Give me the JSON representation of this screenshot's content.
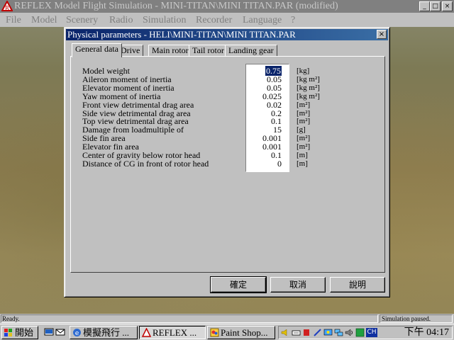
{
  "app": {
    "title": "REFLEX Model Flight Simulation - MINI-TITAN\\MINI TITAN.PAR (modified)",
    "window_buttons": [
      "_",
      "□",
      "×"
    ]
  },
  "menu": {
    "items": [
      "File",
      "Model",
      "Scenery",
      "Radio",
      "Simulation",
      "Recorder",
      "Language",
      "?"
    ]
  },
  "dialog": {
    "title": "Physical parameters - HELI\\MINI-TITAN\\MINI TITAN.PAR",
    "close_label": "×",
    "tabs": [
      "General data",
      "Drive",
      "Main rotor",
      "Tail rotor",
      "Landing gear"
    ],
    "active_tab": 0,
    "params": [
      {
        "label": "Model weight",
        "value": "0.75",
        "unit": "[kg]",
        "selected": true
      },
      {
        "label": "Aileron moment of inertia",
        "value": "0.05",
        "unit": "[kg m²]"
      },
      {
        "label": "Elevator moment of inertia",
        "value": "0.05",
        "unit": "[kg m²]"
      },
      {
        "label": "Yaw moment of inertia",
        "value": "0.025",
        "unit": "[kg m²]"
      },
      {
        "label": "Front view detrimental drag area",
        "value": "0.02",
        "unit": "[m²]"
      },
      {
        "label": "Side view detrimental drag area",
        "value": "0.2",
        "unit": "[m²]"
      },
      {
        "label": "Top view detrimental drag area",
        "value": "0.1",
        "unit": "[m²]"
      },
      {
        "label": "Damage from loadmultiple of",
        "value": "15",
        "unit": "[g]"
      },
      {
        "label": "Side fin area",
        "value": "0.001",
        "unit": "[m²]"
      },
      {
        "label": "Elevator fin area",
        "value": "0.001",
        "unit": "[m²]"
      },
      {
        "label": "Center of gravity below rotor head",
        "value": "0.1",
        "unit": "[m]"
      },
      {
        "label": "Distance of CG in front of rotor head",
        "value": "0",
        "unit": "[m]"
      }
    ],
    "buttons": {
      "ok": "確定",
      "cancel": "取消",
      "help": "說明"
    }
  },
  "status": {
    "left": "Ready.",
    "right": "Simulation paused."
  },
  "taskbar": {
    "start_label": "開始",
    "tasks": [
      {
        "label": "模擬飛行 ...",
        "active": false
      },
      {
        "label": "REFLEX ...",
        "active": true
      },
      {
        "label": "Paint Shop...",
        "active": false
      }
    ],
    "clock": "下午 04:17",
    "tray_lang": "CH"
  }
}
